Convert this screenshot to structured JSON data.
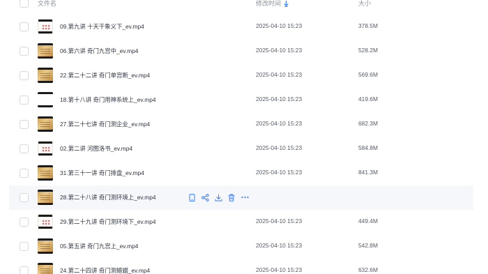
{
  "header": {
    "name_label": "文件名",
    "time_label": "修改时间",
    "size_label": "大小"
  },
  "files": [
    {
      "name": "09.第九讲 十天干象义下_ev.mp4",
      "time": "2025-04-10 15:23",
      "size": "378.5M",
      "thumb": "white-icon"
    },
    {
      "name": "06.第六讲 奇门九宫中_ev.mp4",
      "time": "2025-04-10 15:23",
      "size": "528.2M",
      "thumb": "gold-icon"
    },
    {
      "name": "22.第二十二讲 奇门单宫断_ev.mp4",
      "time": "2025-04-10 15:23",
      "size": "569.6M",
      "thumb": "gold-icon"
    },
    {
      "name": "18.第十八讲 奇门用神系统上_ev.mp4",
      "time": "2025-04-10 15:23",
      "size": "419.6M",
      "thumb": "bw-icon"
    },
    {
      "name": "27.第二十七讲 奇门测企业_ev.mp4",
      "time": "2025-04-10 15:23",
      "size": "682.3M",
      "thumb": "gold-icon"
    },
    {
      "name": "02.第二讲 河图洛书_ev.mp4",
      "time": "2025-04-10 15:23",
      "size": "584.8M",
      "thumb": "white-icon"
    },
    {
      "name": "31.第三十一讲 奇门排盘_ev.mp4",
      "time": "2025-04-10 15:23",
      "size": "841.3M",
      "thumb": "gold-icon"
    },
    {
      "name": "28.第二十八讲 奇门测环境上_ev.mp4",
      "time": "",
      "size": "",
      "thumb": "gold-icon",
      "hovered": true
    },
    {
      "name": "29.第二十九讲 奇门测环境下_ev.mp4",
      "time": "2025-04-10 15:23",
      "size": "449.4M",
      "thumb": "white-icon"
    },
    {
      "name": "05.第五讲 奇门九宫上_ev.mp4",
      "time": "2025-04-10 15:23",
      "size": "542.8M",
      "thumb": "gold-icon"
    },
    {
      "name": "24.第二十四讲 奇门测婚姻_ev.mp4",
      "time": "2025-04-10 15:23",
      "size": "632.6M",
      "thumb": "gold-icon"
    }
  ],
  "hover_actions": [
    "phone-icon",
    "share-icon",
    "download-icon",
    "delete-icon",
    "more-icon"
  ],
  "colors": {
    "accent": "#3b7bf6",
    "hover_bg": "#f6f7fb"
  }
}
